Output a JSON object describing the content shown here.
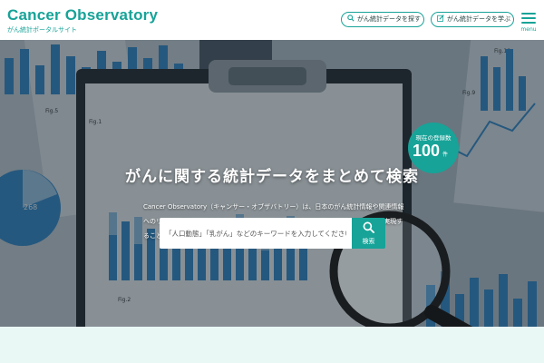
{
  "header": {
    "logo_title": "Cancer Observatory",
    "logo_subtitle": "がん統計ポータルサイト",
    "find_data_label": "がん統計データを探す",
    "learn_data_label": "がん統計データを学ぶ",
    "menu_label": "menu"
  },
  "hero": {
    "title": "がんに関する統計データをまとめて検索",
    "description": "Cancer Observatory（キャンサー・オブザバトリー）は、日本のがん統計情報や関連情報へのリンクを集約しわかりやすく示すことで、がん医療や研究に関わる方のニーズを実現することを目的に発足した共同プロジェクトです。",
    "badge_label": "現在の登録数",
    "badge_count": "100",
    "badge_unit": "件"
  },
  "search": {
    "placeholder": "「人口動態」「乳がん」などのキーワードを入力してください",
    "button_label": "検索"
  },
  "background": {
    "figure_labels": [
      "Fig.5",
      "Fig.1",
      "Fig.10",
      "Fig.2",
      "Fig.9"
    ],
    "pie_value": "268"
  },
  "colors": {
    "brand": "#17a398",
    "hero_overlay": "#1c2a33",
    "bottom_band": "#e9f8f5"
  },
  "icons": {
    "find": "search-icon",
    "learn": "edit-icon",
    "menu": "hamburger-icon",
    "search_button": "search-icon"
  }
}
